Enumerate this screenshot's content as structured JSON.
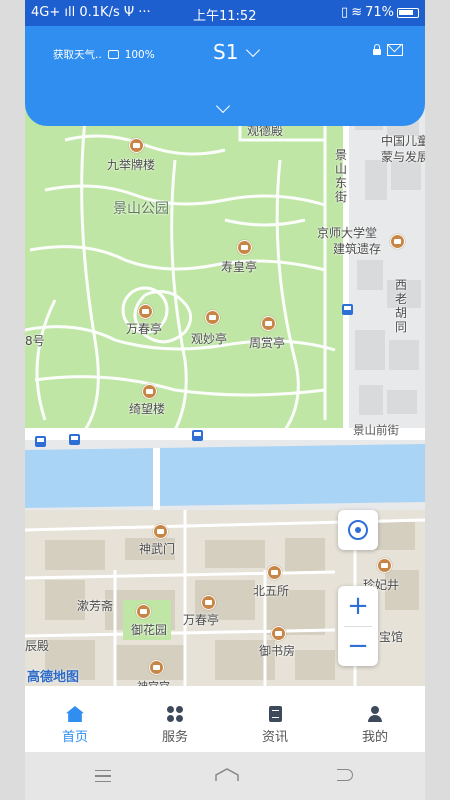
{
  "status_bar": {
    "network": "4G+",
    "speed": "0.1K/s",
    "extra": "··· ",
    "time": "上午11:52",
    "battery": "71%"
  },
  "header": {
    "weather": "获取天气..",
    "battery_pct": "100%",
    "station": "S1"
  },
  "map": {
    "labels": {
      "guandedian": "观德殿",
      "jiujulou": "九举牌楼",
      "jingshan_park": "景山公园",
      "shouhuang": "寿皇亭",
      "wanchun": "万春亭",
      "guanmiao": "观妙亭",
      "zhoushang": "周赏亭",
      "jiwang": "绮望楼",
      "jingshan_front": "景山前街",
      "jingshan_east": "景山东街",
      "jingshi": "京师大学堂",
      "jingshi2": "建筑遗存",
      "zhongguo": "中国儿童",
      "zhongguo2": "蒙与发展",
      "xilao": "西老胡同",
      "bahao": "8号",
      "shenwu": "神武门",
      "beiwu": "北五所",
      "zhenfei": "珍妃井",
      "shufang": "漱芳斋",
      "yuhua": "御花园",
      "wanchun2": "万春亭",
      "yushu": "御书房",
      "chendian": "辰殿",
      "guan": "宝馆",
      "shenwu2": "神宫宫",
      "amap": "高德地图"
    },
    "zoom_in": "+",
    "zoom_out": "−"
  },
  "tabs": [
    {
      "label": "首页",
      "active": true
    },
    {
      "label": "服务",
      "active": false
    },
    {
      "label": "资讯",
      "active": false
    },
    {
      "label": "我的",
      "active": false
    }
  ],
  "colors": {
    "status_bar": "#1e5fd0",
    "header": "#2f8ef0",
    "park_green": "#bfe6a4",
    "water": "#a9d4f5",
    "accent": "#2f8ef0"
  }
}
